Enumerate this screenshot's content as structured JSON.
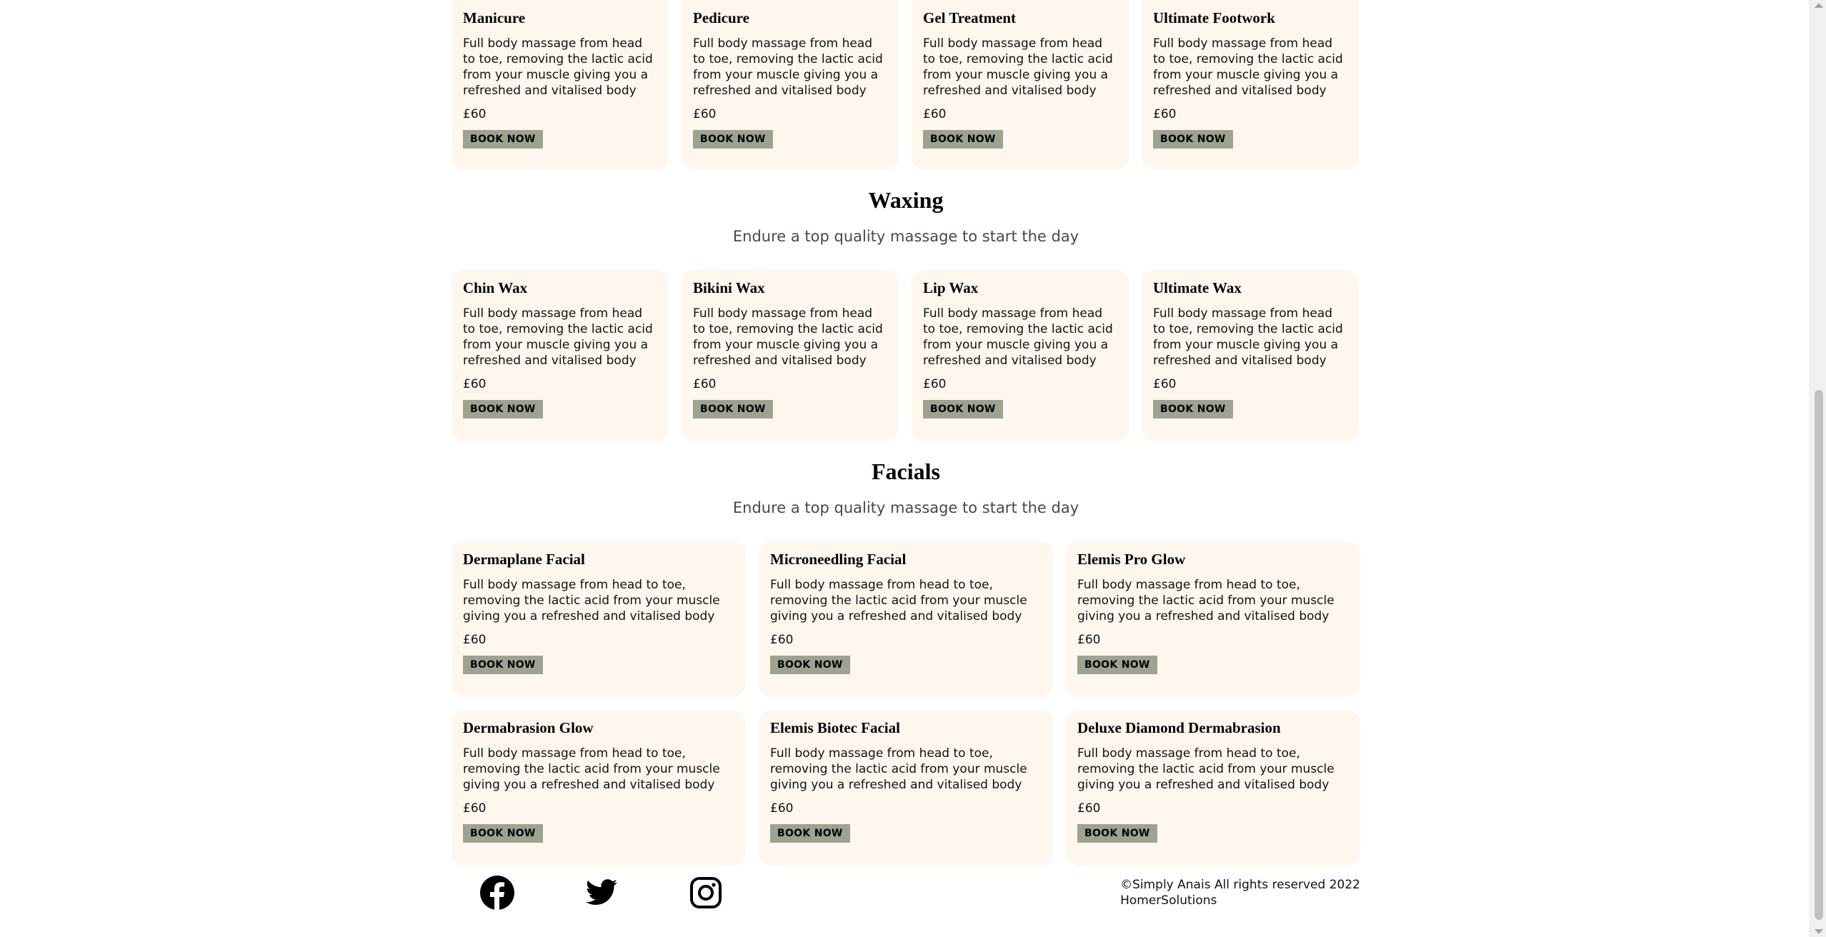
{
  "sections": {
    "nails": {
      "cards": [
        {
          "title": "Manicure",
          "desc": "Full body massage from head to toe, removing the lactic acid from your muscle giving you a refreshed and vitalised body",
          "price": "£60",
          "button": "BOOK NOW"
        },
        {
          "title": "Pedicure",
          "desc": "Full body massage from head to toe, removing the lactic acid from your muscle giving you a refreshed and vitalised body",
          "price": "£60",
          "button": "BOOK NOW"
        },
        {
          "title": "Gel Treatment",
          "desc": "Full body massage from head to toe, removing the lactic acid from your muscle giving you a refreshed and vitalised body",
          "price": "£60",
          "button": "BOOK NOW"
        },
        {
          "title": "Ultimate Footwork",
          "desc": "Full body massage from head to toe, removing the lactic acid from your muscle giving you a refreshed and vitalised body",
          "price": "£60",
          "button": "BOOK NOW"
        }
      ]
    },
    "waxing": {
      "title": "Waxing",
      "subtitle": "Endure a top quality massage to start the day",
      "cards": [
        {
          "title": "Chin Wax",
          "desc": "Full body massage from head to toe, removing the lactic acid from your muscle giving you a refreshed and vitalised body",
          "price": "£60",
          "button": "BOOK NOW"
        },
        {
          "title": "Bikini Wax",
          "desc": "Full body massage from head to toe, removing the lactic acid from your muscle giving you a refreshed and vitalised body",
          "price": "£60",
          "button": "BOOK NOW"
        },
        {
          "title": "Lip Wax",
          "desc": "Full body massage from head to toe, removing the lactic acid from your muscle giving you a refreshed and vitalised body",
          "price": "£60",
          "button": "BOOK NOW"
        },
        {
          "title": "Ultimate Wax",
          "desc": "Full body massage from head to toe, removing the lactic acid from your muscle giving you a refreshed and vitalised body",
          "price": "£60",
          "button": "BOOK NOW"
        }
      ]
    },
    "facials": {
      "title": "Facials",
      "subtitle": "Endure a top quality massage to start the day",
      "cards": [
        {
          "title": "Dermaplane Facial",
          "desc": "Full body massage from head to toe, removing the lactic acid from your muscle giving you a refreshed and vitalised body",
          "price": "£60",
          "button": "BOOK NOW"
        },
        {
          "title": "Microneedling Facial",
          "desc": "Full body massage from head to toe, removing the lactic acid from your muscle giving you a refreshed and vitalised body",
          "price": "£60",
          "button": "BOOK NOW"
        },
        {
          "title": "Elemis Pro Glow",
          "desc": "Full body massage from head to toe, removing the lactic acid from your muscle giving you a refreshed and vitalised body",
          "price": "£60",
          "button": "BOOK NOW"
        },
        {
          "title": "Dermabrasion Glow",
          "desc": "Full body massage from head to toe, removing the lactic acid from your muscle giving you a refreshed and vitalised body",
          "price": "£60",
          "button": "BOOK NOW"
        },
        {
          "title": "Elemis Biotec Facial",
          "desc": "Full body massage from head to toe, removing the lactic acid from your muscle giving you a refreshed and vitalised body",
          "price": "£60",
          "button": "BOOK NOW"
        },
        {
          "title": "Deluxe Diamond Dermabrasion",
          "desc": "Full body massage from head to toe, removing the lactic acid from your muscle giving you a refreshed and vitalised body",
          "price": "£60",
          "button": "BOOK NOW"
        }
      ]
    }
  },
  "footer": {
    "social_icons": [
      "facebook-icon",
      "twitter-icon",
      "instagram-icon"
    ],
    "copyright": "©Simply Anais All rights reserved 2022",
    "credit": "HomerSolutions"
  },
  "colors": {
    "card_bg": "#fff7ee",
    "button_bg": "#9da391",
    "subtitle": "#3f4b4f"
  }
}
